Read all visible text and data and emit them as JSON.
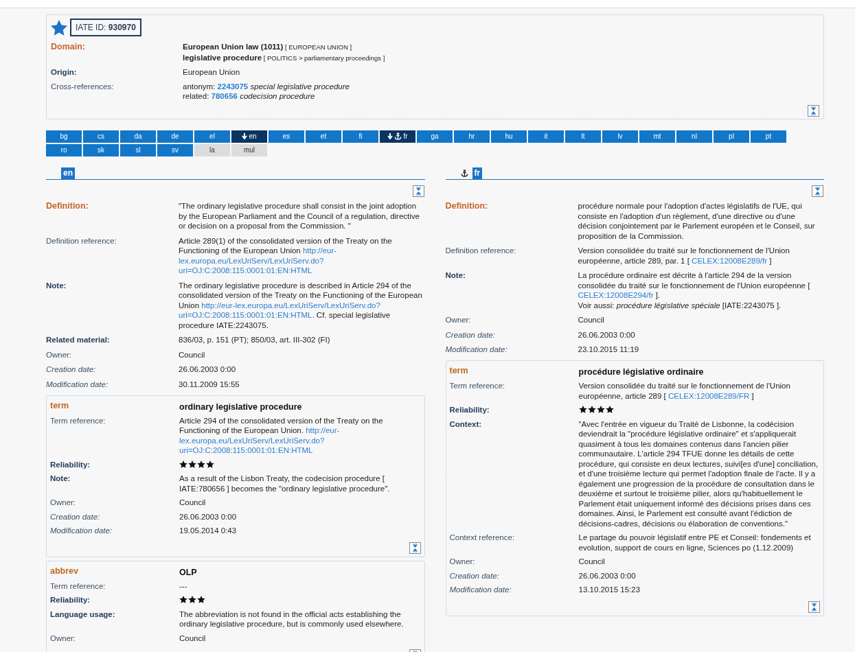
{
  "entry": {
    "id_label": "IATE ID:",
    "id_value": "930970",
    "rows": [
      {
        "label": "Domain:",
        "kind": "heading",
        "lines": [
          [
            {
              "kind": "strong",
              "text": "European Union law (1011)"
            },
            {
              "kind": "small",
              "text": " [ EUROPEAN UNION ]"
            }
          ],
          [
            {
              "kind": "strong",
              "text": "legislative procedure"
            },
            {
              "kind": "small",
              "text": " [ POLITICS > parliamentary proceedings ]"
            }
          ]
        ]
      },
      {
        "label": "Origin:",
        "kind": "bold",
        "lines": [
          [
            {
              "kind": "text",
              "text": "European Union"
            }
          ]
        ]
      },
      {
        "label": "Cross-references:",
        "kind": "plain",
        "lines": [
          [
            {
              "kind": "text",
              "text": "antonym: "
            },
            {
              "kind": "ref",
              "text": "2243075"
            },
            {
              "kind": "text",
              "text": " *special legislative procedure*"
            }
          ],
          [
            {
              "kind": "text",
              "text": "related: "
            },
            {
              "kind": "ref",
              "text": "780656"
            },
            {
              "kind": "text",
              "text": " *codecision procedure*"
            }
          ]
        ]
      }
    ]
  },
  "languages": [
    {
      "label": "bg",
      "selected": false,
      "anchor": false,
      "available": true
    },
    {
      "label": "cs",
      "selected": false,
      "anchor": false,
      "available": true
    },
    {
      "label": "da",
      "selected": false,
      "anchor": false,
      "available": true
    },
    {
      "label": "de",
      "selected": false,
      "anchor": false,
      "available": true
    },
    {
      "label": "el",
      "selected": false,
      "anchor": false,
      "available": true
    },
    {
      "label": "en",
      "selected": true,
      "anchor": false,
      "available": true
    },
    {
      "label": "es",
      "selected": false,
      "anchor": false,
      "available": true
    },
    {
      "label": "et",
      "selected": false,
      "anchor": false,
      "available": true
    },
    {
      "label": "fi",
      "selected": false,
      "anchor": false,
      "available": true
    },
    {
      "label": "fr",
      "selected": true,
      "anchor": true,
      "available": true
    },
    {
      "label": "ga",
      "selected": false,
      "anchor": false,
      "available": true
    },
    {
      "label": "hr",
      "selected": false,
      "anchor": false,
      "available": true
    },
    {
      "label": "hu",
      "selected": false,
      "anchor": false,
      "available": true
    },
    {
      "label": "it",
      "selected": false,
      "anchor": false,
      "available": true
    },
    {
      "label": "lt",
      "selected": false,
      "anchor": false,
      "available": true
    },
    {
      "label": "lv",
      "selected": false,
      "anchor": false,
      "available": true
    },
    {
      "label": "mt",
      "selected": false,
      "anchor": false,
      "available": true
    },
    {
      "label": "nl",
      "selected": false,
      "anchor": false,
      "available": true
    },
    {
      "label": "pl",
      "selected": false,
      "anchor": false,
      "available": true
    },
    {
      "label": "pt",
      "selected": false,
      "anchor": false,
      "available": true
    },
    {
      "label": "ro",
      "selected": false,
      "anchor": false,
      "available": true
    },
    {
      "label": "sk",
      "selected": false,
      "anchor": false,
      "available": true
    },
    {
      "label": "sl",
      "selected": false,
      "anchor": false,
      "available": true
    },
    {
      "label": "sv",
      "selected": false,
      "anchor": false,
      "available": true
    },
    {
      "label": "la",
      "selected": false,
      "anchor": false,
      "available": false
    },
    {
      "label": "mul",
      "selected": false,
      "anchor": false,
      "available": false
    }
  ],
  "panels": [
    {
      "language": "en",
      "anchor": false,
      "rows": [
        {
          "label": "Definition:",
          "kind": "heading",
          "lines": [
            [
              {
                "kind": "text",
                "text": "\"The ordinary legislative procedure shall consist in the joint adoption by the European Parliament and the Council of a regulation, directive or decision on a proposal from the Commission. \""
              }
            ]
          ]
        },
        {
          "label": "Definition reference:",
          "kind": "plain",
          "lines": [
            [
              {
                "kind": "text",
                "text": "Article 289(1) of the consolidated version of the Treaty on the Functioning of the European Union "
              },
              {
                "kind": "link",
                "text": "http://eur-"
              },
              {
                "kind": "link",
                "text": "lex.europa.eu/LexUriServ/LexUriServ.do?"
              },
              {
                "kind": "link",
                "text": "uri=OJ:C:2008:115:0001:01:EN:HTML"
              }
            ]
          ]
        },
        {
          "label": "Note:",
          "kind": "bold",
          "lines": [
            [
              {
                "kind": "text",
                "text": "The ordinary legislative procedure is described in Article 294 of the consolidated version of the Treaty on the Functioning of the European Union "
              },
              {
                "kind": "link",
                "text": "http://eur-lex.europa.eu/LexUriServ/LexUriServ.do?"
              },
              {
                "kind": "link",
                "text": "uri=OJ:C:2008:115:0001:01:EN:HTML."
              },
              {
                "kind": "text",
                "text": " Cf. special legislative procedure IATE:2243075."
              }
            ]
          ]
        },
        {
          "label": "Related material:",
          "kind": "bold",
          "lines": [
            [
              {
                "kind": "text",
                "text": "836/03, p. 151 (PT); 850/03, art. III-302 (FI)"
              }
            ]
          ]
        },
        {
          "label": "Owner:",
          "kind": "plain",
          "lines": [
            [
              {
                "kind": "text",
                "text": "Council"
              }
            ]
          ]
        },
        {
          "label": "Creation date:",
          "kind": "italic",
          "lines": [
            [
              {
                "kind": "text",
                "text": "26.06.2003 0:00"
              }
            ]
          ]
        },
        {
          "label": "Modification date:",
          "kind": "italic",
          "lines": [
            [
              {
                "kind": "text",
                "text": "30.11.2009 15:55"
              }
            ]
          ]
        }
      ],
      "terms": [
        {
          "type": "term",
          "term": "ordinary legislative procedure",
          "rows": [
            {
              "label": "Term reference:",
              "kind": "plain",
              "lines": [
                [
                  {
                    "kind": "text",
                    "text": "Article 294 of the consolidated version of the Treaty on the Functioning of the European Union. "
                  },
                  {
                    "kind": "link",
                    "text": "http://eur-"
                  },
                  {
                    "kind": "link",
                    "text": "lex.europa.eu/LexUriServ/LexUriServ.do?"
                  },
                  {
                    "kind": "link",
                    "text": "uri=OJ:C:2008:115:0001:01:EN:HTML"
                  }
                ]
              ]
            },
            {
              "label": "Reliability:",
              "kind": "bold",
              "stars": 4
            },
            {
              "label": "Note:",
              "kind": "bold",
              "lines": [
                [
                  {
                    "kind": "text",
                    "text": "As a result of the Lisbon Treaty, the codecision procedure [ IATE:780656 ] becomes the \"ordinary legislative procedure\"."
                  }
                ]
              ]
            },
            {
              "label": "Owner:",
              "kind": "plain",
              "lines": [
                [
                  {
                    "kind": "text",
                    "text": "Council"
                  }
                ]
              ]
            },
            {
              "label": "Creation date:",
              "kind": "italic",
              "lines": [
                [
                  {
                    "kind": "text",
                    "text": "26.06.2003 0:00"
                  }
                ]
              ]
            },
            {
              "label": "Modification date:",
              "kind": "italic",
              "lines": [
                [
                  {
                    "kind": "text",
                    "text": "19.05.2014 0:43"
                  }
                ]
              ]
            }
          ]
        },
        {
          "type": "abbrev",
          "term": "OLP",
          "rows": [
            {
              "label": "Term reference:",
              "kind": "plain",
              "lines": [
                [
                  {
                    "kind": "text",
                    "text": "---"
                  }
                ]
              ]
            },
            {
              "label": "Reliability:",
              "kind": "bold",
              "stars": 3
            },
            {
              "label": "Language usage:",
              "kind": "bold",
              "lines": [
                [
                  {
                    "kind": "text",
                    "text": "The abbreviation is not found in the official acts establishing the ordinary legislative procedure, but is commonly used elsewhere."
                  }
                ]
              ]
            },
            {
              "label": "Owner:",
              "kind": "plain",
              "lines": [
                [
                  {
                    "kind": "text",
                    "text": "Council"
                  }
                ]
              ]
            }
          ]
        }
      ]
    },
    {
      "language": "fr",
      "anchor": true,
      "rows": [
        {
          "label": "Definition:",
          "kind": "heading",
          "lines": [
            [
              {
                "kind": "text",
                "text": "procédure normale pour l'adoption d'actes législatifs de l'UE, qui consiste en l'adoption d'un règlement, d'une directive ou d'une décision conjointement par le Parlement européen et le Conseil, sur proposition de la Commission."
              }
            ]
          ]
        },
        {
          "label": "Definition reference:",
          "kind": "plain",
          "lines": [
            [
              {
                "kind": "text",
                "text": "Version consolidée du traité sur le fonctionnement de l'Union européenne, article 289, par. 1 [ "
              },
              {
                "kind": "link",
                "text": "CELEX:12008E289/fr"
              },
              {
                "kind": "text",
                "text": " ]"
              }
            ]
          ]
        },
        {
          "label": "Note:",
          "kind": "bold",
          "lines": [
            [
              {
                "kind": "text",
                "text": "La procédure ordinaire est décrite à l'article 294 de la version consolidée du traité sur le fonctionnement de l'Union européenne [ "
              },
              {
                "kind": "link",
                "text": "CELEX:12008E294/fr"
              },
              {
                "kind": "text",
                "text": " ]."
              }
            ],
            [
              {
                "kind": "text",
                "text": "Voir aussi: *procédure législative spéciale* [IATE:2243075 ]."
              }
            ]
          ]
        },
        {
          "label": "Owner:",
          "kind": "plain",
          "lines": [
            [
              {
                "kind": "text",
                "text": "Council"
              }
            ]
          ]
        },
        {
          "label": "Creation date:",
          "kind": "italic",
          "lines": [
            [
              {
                "kind": "text",
                "text": "26.06.2003 0:00"
              }
            ]
          ]
        },
        {
          "label": "Modification date:",
          "kind": "italic",
          "lines": [
            [
              {
                "kind": "text",
                "text": "23.10.2015 11:19"
              }
            ]
          ]
        }
      ],
      "terms": [
        {
          "type": "term",
          "term": "procédure législative ordinaire",
          "rows": [
            {
              "label": "Term reference:",
              "kind": "plain",
              "lines": [
                [
                  {
                    "kind": "text",
                    "text": "Version consolidée du traité sur le fonctionnement de l'Union européenne, article 289 [ "
                  },
                  {
                    "kind": "link",
                    "text": "CELEX:12008E289/FR"
                  },
                  {
                    "kind": "text",
                    "text": " ]"
                  }
                ]
              ]
            },
            {
              "label": "Reliability:",
              "kind": "bold",
              "stars": 4
            },
            {
              "label": "Context:",
              "kind": "bold",
              "lines": [
                [
                  {
                    "kind": "text",
                    "text": "\"Avec l'entrée en vigueur du Traité de Lisbonne, la codécision deviendrait la \"procédure législative ordinaire\" et s'appliquerait quasiment à tous les domaines contenus dans l'ancien pilier communautaire. L'article 294 TFUE donne les détails de cette procédure, qui consiste en deux lectures, suivi[es d'une] conciliation, et d'une troisième lecture qui permet l'adoption finale de l'acte. Il y a également une progression de la procédure de consultation dans le deuxième et surtout le troisième pilier, alors qu'habituellement le Parlement était uniquement informé des décisions prises dans ces domaines. Ainsi, le Parlement est consulté avant l'édiction de décisions-cadres, décisions ou élaboration de conventions.\""
                  }
                ]
              ]
            },
            {
              "label": "Context reference:",
              "kind": "plain",
              "lines": [
                [
                  {
                    "kind": "text",
                    "text": "Le partage du pouvoir législatif entre PE et Conseil: fondements et evolution, support de cours en ligne, Sciences po (1.12.2009)"
                  }
                ]
              ]
            },
            {
              "label": "Owner:",
              "kind": "plain",
              "lines": [
                [
                  {
                    "kind": "text",
                    "text": "Council"
                  }
                ]
              ]
            },
            {
              "label": "Creation date:",
              "kind": "italic",
              "lines": [
                [
                  {
                    "kind": "text",
                    "text": "26.06.2003 0:00"
                  }
                ]
              ]
            },
            {
              "label": "Modification date:",
              "kind": "italic",
              "lines": [
                [
                  {
                    "kind": "text",
                    "text": "13.10.2015 15:23"
                  }
                ]
              ]
            }
          ]
        }
      ]
    }
  ]
}
